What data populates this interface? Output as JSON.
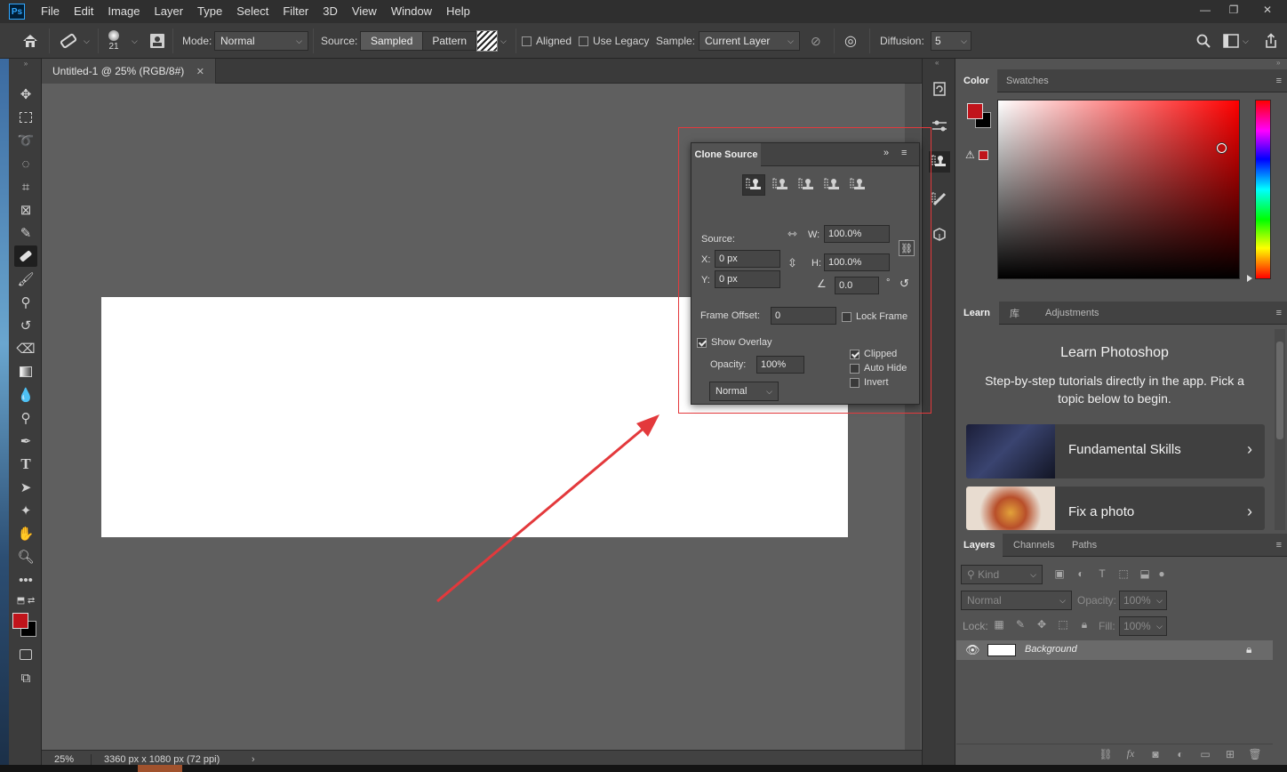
{
  "menubar": {
    "logo": "Ps",
    "items": [
      "File",
      "Edit",
      "Image",
      "Layer",
      "Type",
      "Select",
      "Filter",
      "3D",
      "View",
      "Window",
      "Help"
    ]
  },
  "options": {
    "brush_size": "21",
    "mode_label": "Mode:",
    "mode_value": "Normal",
    "source_label": "Source:",
    "sampled": "Sampled",
    "pattern": "Pattern",
    "aligned": "Aligned",
    "use_legacy": "Use Legacy",
    "sample_label": "Sample:",
    "sample_value": "Current Layer",
    "diffusion_label": "Diffusion:",
    "diffusion_value": "5"
  },
  "document": {
    "tab_title": "Untitled-1 @ 25% (RGB/8#)",
    "zoom": "25%",
    "info": "3360 px x 1080 px (72 ppi)"
  },
  "clone_source": {
    "title": "Clone Source",
    "source_label": "Source:",
    "x_label": "X:",
    "x_value": "0 px",
    "y_label": "Y:",
    "y_value": "0 px",
    "w_label": "W:",
    "w_value": "100.0%",
    "h_label": "H:",
    "h_value": "100.0%",
    "angle_value": "0.0",
    "degree": "°",
    "frame_offset_label": "Frame Offset:",
    "frame_offset_value": "0",
    "lock_frame": "Lock Frame",
    "show_overlay": "Show Overlay",
    "opacity_label": "Opacity:",
    "opacity_value": "100%",
    "blend_value": "Normal",
    "clipped": "Clipped",
    "auto_hide": "Auto Hide",
    "invert": "Invert"
  },
  "color_panel": {
    "tabs": [
      "Color",
      "Swatches"
    ],
    "foreground": "#c0141b",
    "background": "#000000"
  },
  "learn_panel": {
    "tabs": [
      "Learn",
      "库",
      "Adjustments"
    ],
    "title": "Learn Photoshop",
    "subtitle": "Step-by-step tutorials directly in the app. Pick a topic below to begin.",
    "cards": [
      "Fundamental Skills",
      "Fix a photo"
    ]
  },
  "layers_panel": {
    "tabs": [
      "Layers",
      "Channels",
      "Paths"
    ],
    "kind_placeholder": "Kind",
    "blend_mode": "Normal",
    "opacity_label": "Opacity:",
    "opacity_value": "100%",
    "lock_label": "Lock:",
    "fill_label": "Fill:",
    "fill_value": "100%",
    "layer_name": "Background"
  }
}
